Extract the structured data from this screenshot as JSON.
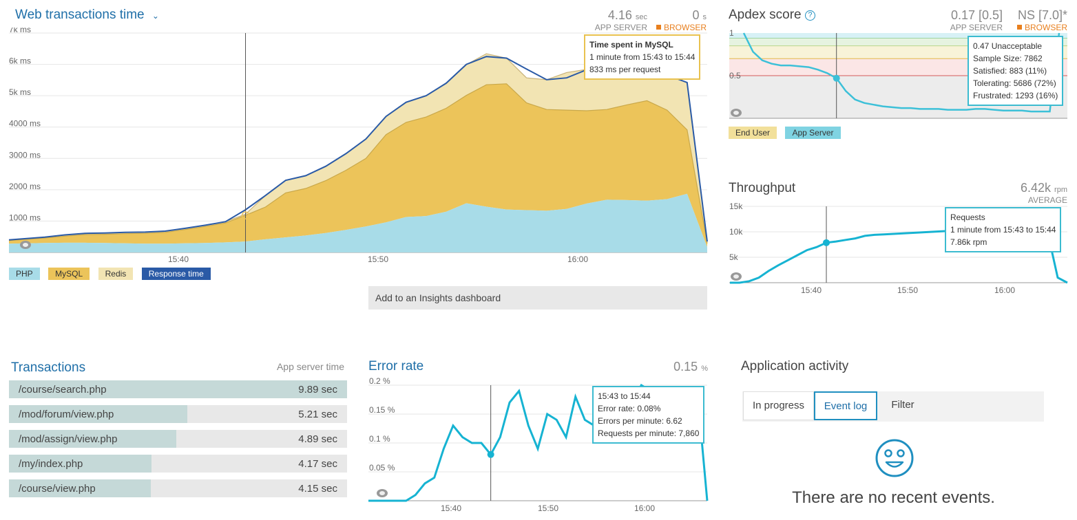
{
  "web_tx": {
    "title": "Web transactions time",
    "app_value": "4.16",
    "app_unit": "sec",
    "app_label": "APP SERVER",
    "browser_value": "0",
    "browser_unit": "s",
    "browser_label": "BROWSER",
    "legend": [
      "PHP",
      "MySQL",
      "Redis",
      "Response time"
    ],
    "tooltip": {
      "title": "Time spent in MySQL",
      "line1": "1 minute from 15:43 to 15:44",
      "line2": "833 ms per request"
    },
    "insights_button": "Add to an Insights dashboard",
    "colors": {
      "php": "#a8dce8",
      "mysql": "#ecc45a",
      "redis": "#f2e4b3",
      "response": "#2a5aa6"
    }
  },
  "apdex": {
    "title": "Apdex score",
    "app_value": "0.17 [0.5]",
    "app_label": "APP SERVER",
    "browser_value": "NS [7.0]*",
    "browser_label": "BROWSER",
    "legend": [
      "End User",
      "App Server"
    ],
    "tooltip": [
      "0.47 Unacceptable",
      "Sample Size: 7862",
      "Satisfied: 883 (11%)",
      "Tolerating: 5686 (72%)",
      "Frustrated: 1293 (16%)"
    ]
  },
  "throughput": {
    "title": "Throughput",
    "value": "6.42k",
    "unit": "rpm",
    "sub": "AVERAGE",
    "tooltip": [
      "Requests",
      "1 minute from 15:43 to 15:44",
      "7.86k rpm"
    ]
  },
  "transactions": {
    "title": "Transactions",
    "column": "App server time",
    "rows": [
      {
        "name": "/course/search.php",
        "value": "9.89 sec",
        "fraction": 1.0
      },
      {
        "name": "/mod/forum/view.php",
        "value": "5.21 sec",
        "fraction": 0.527
      },
      {
        "name": "/mod/assign/view.php",
        "value": "4.89 sec",
        "fraction": 0.494
      },
      {
        "name": "/my/index.php",
        "value": "4.17 sec",
        "fraction": 0.421
      },
      {
        "name": "/course/view.php",
        "value": "4.15 sec",
        "fraction": 0.42
      }
    ]
  },
  "error_rate": {
    "title": "Error rate",
    "value": "0.15",
    "unit": "%",
    "tooltip": [
      "15:43 to 15:44",
      "Error rate: 0.08%",
      "Errors per minute: 6.62",
      "Requests per minute: 7,860"
    ]
  },
  "activity": {
    "title": "Application activity",
    "tabs": [
      "In progress",
      "Event log",
      "Filter"
    ],
    "active_tab": "Event log",
    "empty_message": "There are no recent events."
  },
  "chart_data": [
    {
      "type": "area",
      "title": "Web transactions time",
      "x": [
        "15:33",
        "15:34",
        "15:35",
        "15:36",
        "15:37",
        "15:38",
        "15:39",
        "15:40",
        "15:41",
        "15:42",
        "15:43",
        "15:44",
        "15:45",
        "15:46",
        "15:47",
        "15:48",
        "15:49",
        "15:50",
        "15:51",
        "15:52",
        "15:53",
        "15:54",
        "15:55",
        "15:56",
        "15:57",
        "15:58",
        "15:59",
        "16:00",
        "16:01",
        "16:02",
        "16:03",
        "16:04",
        "16:05",
        "16:06"
      ],
      "xticks": [
        "15:40",
        "15:50",
        "16:00"
      ],
      "yticks": [
        "1000 ms",
        "2000 ms",
        "3000 ms",
        "4000 ms",
        "5k ms",
        "6k ms",
        "7k ms"
      ],
      "ylim": [
        0,
        7000
      ],
      "series": [
        {
          "name": "PHP",
          "values": [
            280,
            300,
            310,
            310,
            300,
            290,
            280,
            280,
            290,
            300,
            320,
            350,
            420,
            480,
            540,
            620,
            720,
            830,
            960,
            1130,
            1160,
            1300,
            1570,
            1460,
            1370,
            1350,
            1330,
            1390,
            1560,
            1680,
            1670,
            1650,
            1700,
            1870,
            170
          ]
        },
        {
          "name": "MySQL",
          "values": [
            100,
            160,
            210,
            260,
            280,
            310,
            330,
            360,
            440,
            530,
            620,
            833,
            1030,
            1420,
            1500,
            1670,
            1900,
            2170,
            2800,
            3020,
            3160,
            3300,
            3440,
            3890,
            4010,
            3420,
            3230,
            3150,
            2960,
            2880,
            3040,
            3190,
            2840,
            2040,
            120
          ]
        },
        {
          "name": "Redis",
          "values": [
            20,
            30,
            40,
            40,
            40,
            40,
            40,
            40,
            40,
            40,
            40,
            40,
            370,
            400,
            410,
            460,
            530,
            620,
            580,
            640,
            680,
            790,
            980,
            990,
            820,
            800,
            950,
            1200,
            1320,
            1370,
            1080,
            960,
            1120,
            1510,
            60
          ]
        },
        {
          "name": "Response time",
          "values": [
            400,
            490,
            560,
            610,
            620,
            640,
            650,
            680,
            770,
            870,
            980,
            1360,
            1820,
            2300,
            2450,
            2750,
            3150,
            3620,
            4340,
            4790,
            5000,
            5400,
            6000,
            6250,
            6200,
            5850,
            5510,
            5570,
            5830,
            5930,
            5790,
            5800,
            5660,
            5420,
            350
          ]
        }
      ]
    },
    {
      "type": "line",
      "title": "Apdex score",
      "ylim": [
        0,
        1
      ],
      "yticks": [
        "0.5",
        "1"
      ],
      "series": [
        {
          "name": "App Server",
          "values": [
            1.0,
            0.78,
            0.68,
            0.64,
            0.62,
            0.62,
            0.61,
            0.6,
            0.57,
            0.53,
            0.47,
            0.32,
            0.22,
            0.18,
            0.16,
            0.14,
            0.13,
            0.12,
            0.12,
            0.11,
            0.11,
            0.11,
            0.1,
            0.1,
            0.1,
            0.11,
            0.11,
            0.1,
            0.09,
            0.09,
            0.09,
            0.08,
            0.08,
            0.08,
            1.0
          ]
        }
      ]
    },
    {
      "type": "line",
      "title": "Throughput",
      "ylim": [
        0,
        15000
      ],
      "yticks": [
        "5k",
        "10k",
        "15k"
      ],
      "xticks": [
        "15:40",
        "15:50",
        "16:00"
      ],
      "series": [
        {
          "name": "Requests",
          "values": [
            0,
            0,
            300,
            1000,
            2300,
            3400,
            4400,
            5400,
            6400,
            7000,
            7860,
            8100,
            8400,
            8700,
            9200,
            9400,
            9500,
            9600,
            9700,
            9800,
            9900,
            10000,
            10100,
            10200,
            10100,
            10000,
            10000,
            10100,
            10100,
            10200,
            10100,
            10000,
            9800,
            9500,
            1000,
            0
          ]
        }
      ]
    },
    {
      "type": "line",
      "title": "Error rate",
      "ylim": [
        0,
        0.2
      ],
      "yticks": [
        "0.05 %",
        "0.1 %",
        "0.15 %",
        "0.2 %"
      ],
      "xticks": [
        "15:40",
        "15:50",
        "16:00"
      ],
      "series": [
        {
          "name": "Error rate",
          "values": [
            0,
            0,
            0,
            0,
            0,
            0.01,
            0.03,
            0.04,
            0.09,
            0.13,
            0.11,
            0.1,
            0.1,
            0.08,
            0.11,
            0.17,
            0.19,
            0.13,
            0.09,
            0.15,
            0.14,
            0.11,
            0.18,
            0.14,
            0.13,
            0.12,
            0.18,
            0.15,
            0.17,
            0.2,
            0.19,
            0.16,
            0.18,
            0.15,
            0.14,
            0.18,
            0.0
          ]
        }
      ]
    }
  ]
}
